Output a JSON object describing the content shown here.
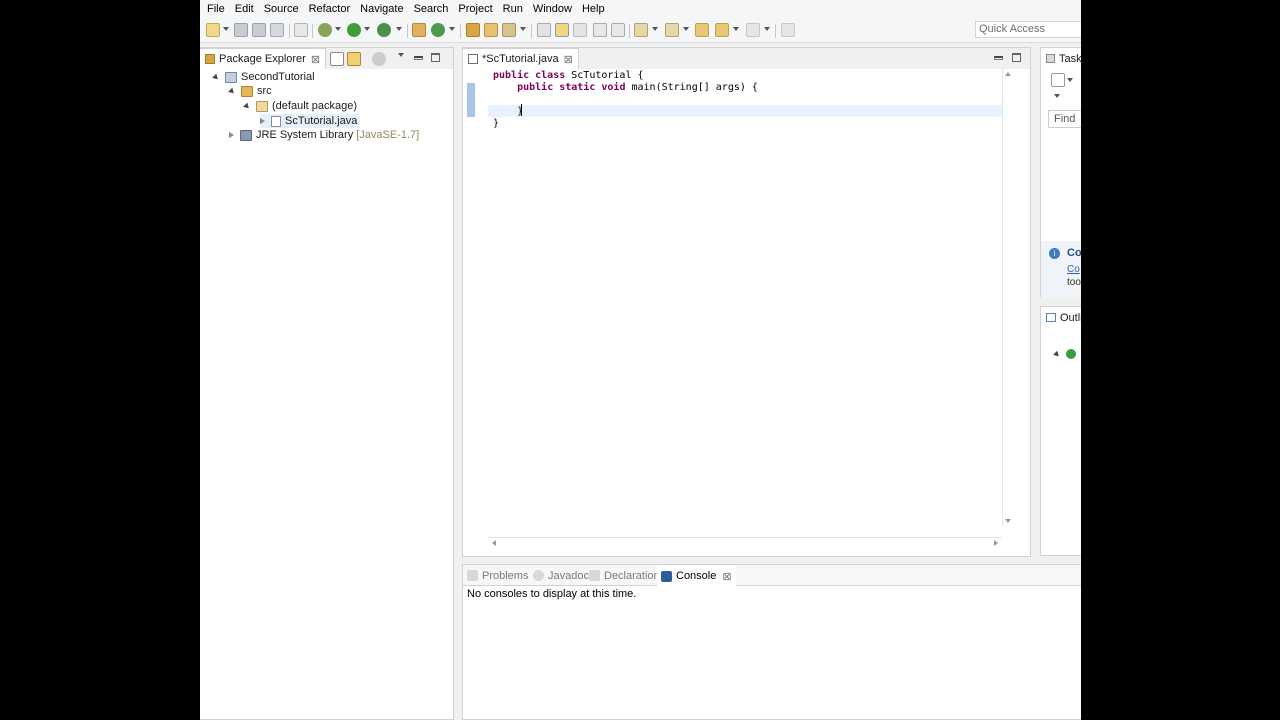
{
  "menubar": {
    "items": [
      "File",
      "Edit",
      "Source",
      "Refactor",
      "Navigate",
      "Search",
      "Project",
      "Run",
      "Window",
      "Help"
    ]
  },
  "toolbar": {
    "quick_access_placeholder": "Quick Access"
  },
  "package_explorer": {
    "title": "Package Explorer",
    "close": "⊠",
    "tree": {
      "project": "SecondTutorial",
      "src": "src",
      "package": "(default package)",
      "file": "ScTutorial.java",
      "library": "JRE System Library",
      "library_version": "[JavaSE-1.7]"
    }
  },
  "editor": {
    "tab_label": "*ScTutorial.java",
    "close": "⊠",
    "code": {
      "line1_kw": "public class",
      "line1_rest": " ScTutorial {",
      "line2_kw": "public static void",
      "line2_rest": " main(String[] args) {",
      "line3": "}",
      "line4": "}"
    }
  },
  "side": {
    "tasks_label": "Task",
    "find_label": "Find",
    "connect_label": "Co",
    "connect_link": "Co",
    "connect_text": "too",
    "outline_label": "Outli"
  },
  "console": {
    "tabs": {
      "problems": "Problems",
      "javadoc": "Javadoc",
      "declaration": "Declaration",
      "console": "Console"
    },
    "close": "⊠",
    "message": "No consoles to display at this time."
  },
  "colors": {
    "keyword": "#7f0055",
    "ruler": "#a9c4e6",
    "library_version": "#94885c"
  }
}
